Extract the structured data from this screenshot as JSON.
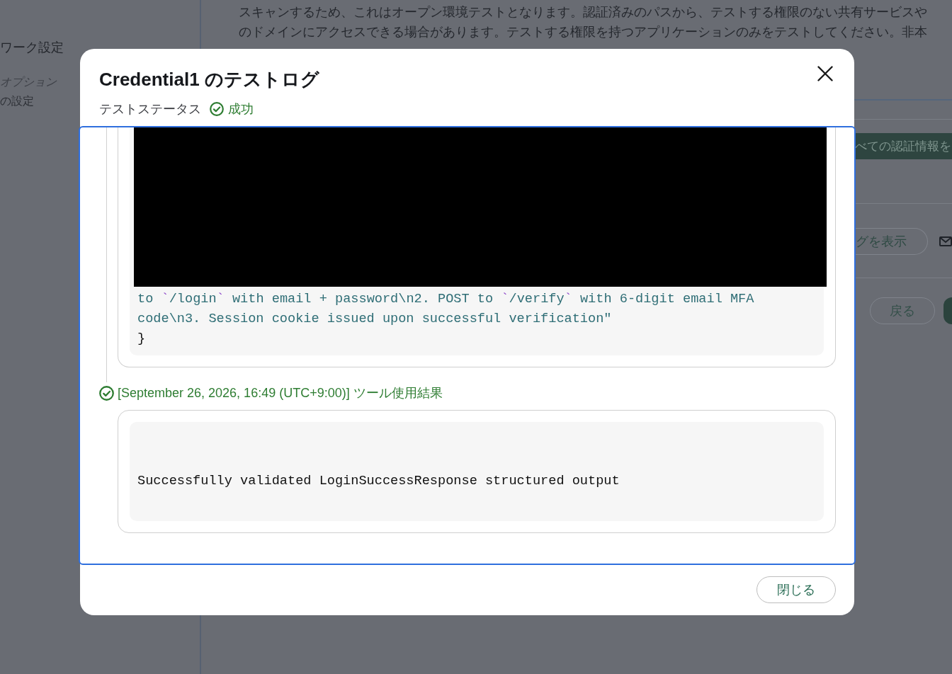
{
  "background": {
    "sidebar": {
      "items": [
        {
          "label": "ワーク設定",
          "kind": "heading"
        },
        {
          "label": "オプション",
          "kind": "hint"
        },
        {
          "label": "の設定",
          "kind": "item"
        }
      ]
    },
    "notice_lines": [
      "スキャンするため、これはオープン環境テストとなります。認証済みのパスから、テストする権限のない共有サービスや",
      "のドメインにアクセスできる場合があります。テストする権限を持つアプリケーションのみをテストしてください。非本"
    ],
    "actions": {
      "primary_button": "べての認証情報を",
      "log_button": "グを表示",
      "back_button": "戻る"
    }
  },
  "dialog": {
    "title": "Credential1 のテストログ",
    "status": {
      "label": "テストステータス",
      "text": "成功",
      "kind": "success"
    },
    "log_focused": true,
    "entries": [
      {
        "kind": "code",
        "redacted": true,
        "lines": [
          {
            "segments": [
              {
                "kind": "string",
                "text": "to "
              },
              {
                "kind": "tick",
                "text": "`"
              },
              {
                "kind": "string",
                "text": "/login"
              },
              {
                "kind": "tick",
                "text": "`"
              },
              {
                "kind": "string",
                "text": " with email + password\\n2. POST to "
              },
              {
                "kind": "tick",
                "text": "`"
              },
              {
                "kind": "string",
                "text": "/verify"
              },
              {
                "kind": "tick",
                "text": "`"
              },
              {
                "kind": "string",
                "text": " with 6-digit email MFA"
              }
            ]
          },
          {
            "segments": [
              {
                "kind": "string",
                "text": "code\\n3. Session cookie issued upon successful verification\""
              }
            ]
          },
          {
            "segments": [
              {
                "kind": "punct",
                "text": "}"
              }
            ]
          }
        ]
      },
      {
        "kind": "result",
        "success": true,
        "heading": "[September 26, 2026, 16:49 (UTC+9:00)] ツール使用結果",
        "output": "Successfully validated LoginSuccessResponse structured output"
      }
    ],
    "close_button": "閉じる"
  }
}
